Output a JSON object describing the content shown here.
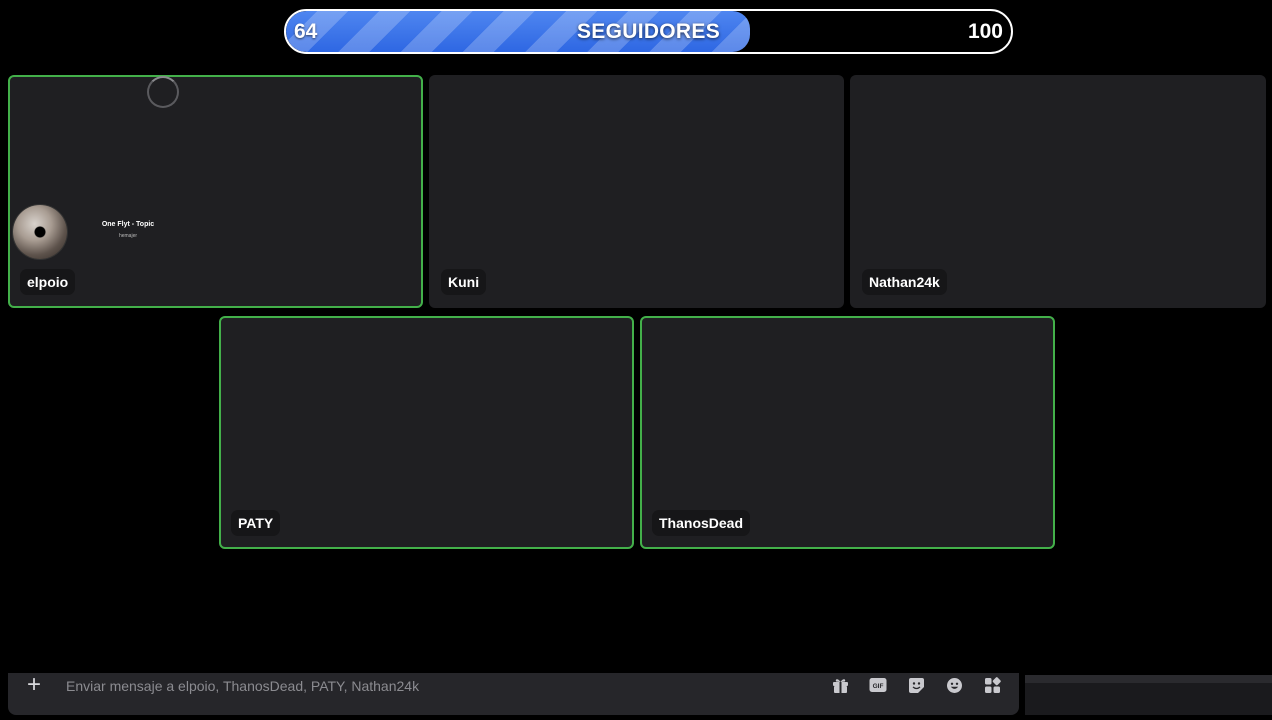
{
  "followers": {
    "current": "64",
    "goal": "100",
    "label": "SEGUIDORES",
    "progress": 0.64,
    "fill_color": "#2e67e3"
  },
  "participants": [
    {
      "name": "elpoio",
      "speaking": true
    },
    {
      "name": "Kuni",
      "speaking": false
    },
    {
      "name": "Nathan24k",
      "speaking": false
    },
    {
      "name": "PATY",
      "speaking": true
    },
    {
      "name": "ThanosDead",
      "speaking": true
    }
  ],
  "activity": {
    "title": "One Flyt - Topic",
    "subtitle": "hemajer"
  },
  "message_bar": {
    "placeholder": "Enviar mensaje a elpoio, ThanosDead, PATY, Nathan24k",
    "icons": [
      "gift-icon",
      "gif-icon",
      "sticker-icon",
      "emoji-icon",
      "apps-icon"
    ]
  },
  "colors": {
    "speaking_border": "#43b04a",
    "tile_bg": "#1f1f22",
    "background": "#000000"
  }
}
